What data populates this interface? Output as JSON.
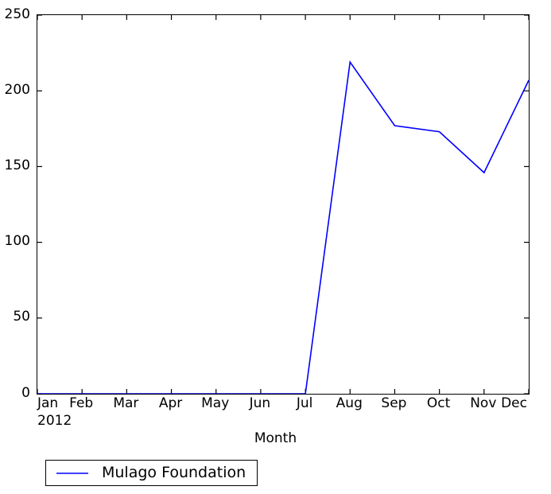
{
  "chart_data": {
    "type": "line",
    "title": "",
    "subtitle": "",
    "xlabel": "Month",
    "ylabel": "",
    "categories": [
      "Jan",
      "Feb",
      "Mar",
      "Apr",
      "May",
      "Jun",
      "Jul",
      "Aug",
      "Sep",
      "Oct",
      "Nov",
      "Dec"
    ],
    "x_sublabels": [
      "2012",
      "",
      "",
      "",
      "",
      "",
      "",
      "",
      "",
      "",
      "",
      ""
    ],
    "series": [
      {
        "name": "Mulago Foundation",
        "color": "#0000ff",
        "values": [
          0,
          0,
          0,
          0,
          0,
          0,
          0,
          219,
          177,
          173,
          146,
          207
        ]
      }
    ],
    "ylim": [
      0,
      250
    ],
    "yticks": [
      0,
      50,
      100,
      150,
      200,
      250
    ],
    "ytick_labels": [
      "0",
      "50",
      "100",
      "150",
      "200",
      "250"
    ],
    "xlim": [
      0,
      11
    ],
    "grid": false,
    "legend": {
      "position": "below-axes-left",
      "entries": [
        {
          "label": "Mulago Foundation",
          "color": "#0000ff"
        }
      ]
    }
  },
  "axis": {
    "x_title": "Month"
  }
}
